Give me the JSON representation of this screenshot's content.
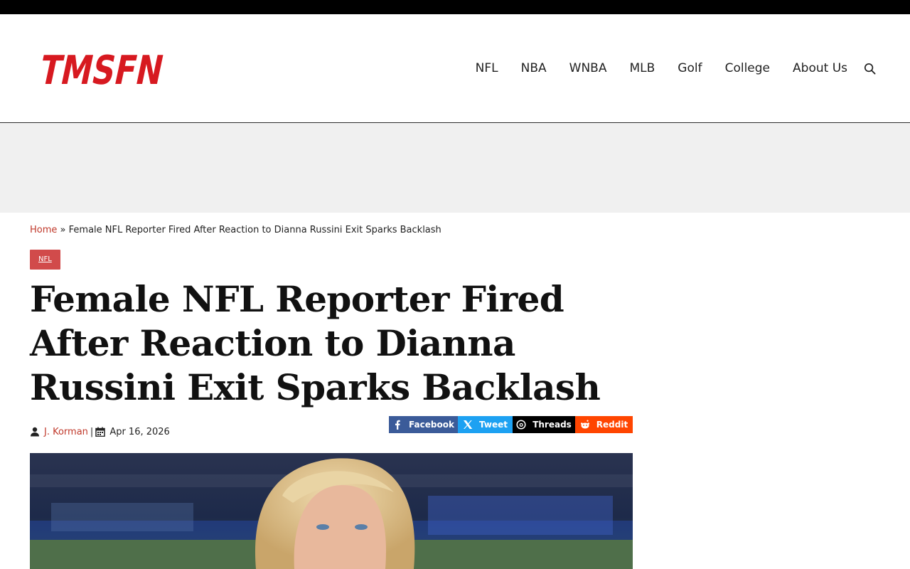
{
  "site": {
    "logo_text": "TMSFN",
    "brand_color": "#d71920"
  },
  "nav": {
    "items": [
      "NFL",
      "NBA",
      "WNBA",
      "MLB",
      "Golf",
      "College",
      "About Us"
    ],
    "search_icon": "search-icon"
  },
  "breadcrumb": {
    "home": "Home",
    "separator": "»",
    "current": "Female NFL Reporter Fired After Reaction to Dianna Russini Exit Sparks Backlash"
  },
  "article": {
    "category": "NFL",
    "title": "Female NFL Reporter Fired After Reaction to Dianna Russini Exit Sparks Backlash",
    "author": "J. Korman",
    "meta_separator": "|",
    "date": "Apr 16, 2026"
  },
  "share": {
    "facebook": "Facebook",
    "tweet": "Tweet",
    "threads": "Threads",
    "reddit": "Reddit",
    "colors": {
      "facebook": "#3b5b99",
      "tweet": "#1da1f2",
      "threads": "#000000",
      "reddit": "#ff4500"
    }
  },
  "colors": {
    "accent": "#c0392b",
    "category_badge": "#d14b4b",
    "ad_band": "#f0f0f0"
  }
}
